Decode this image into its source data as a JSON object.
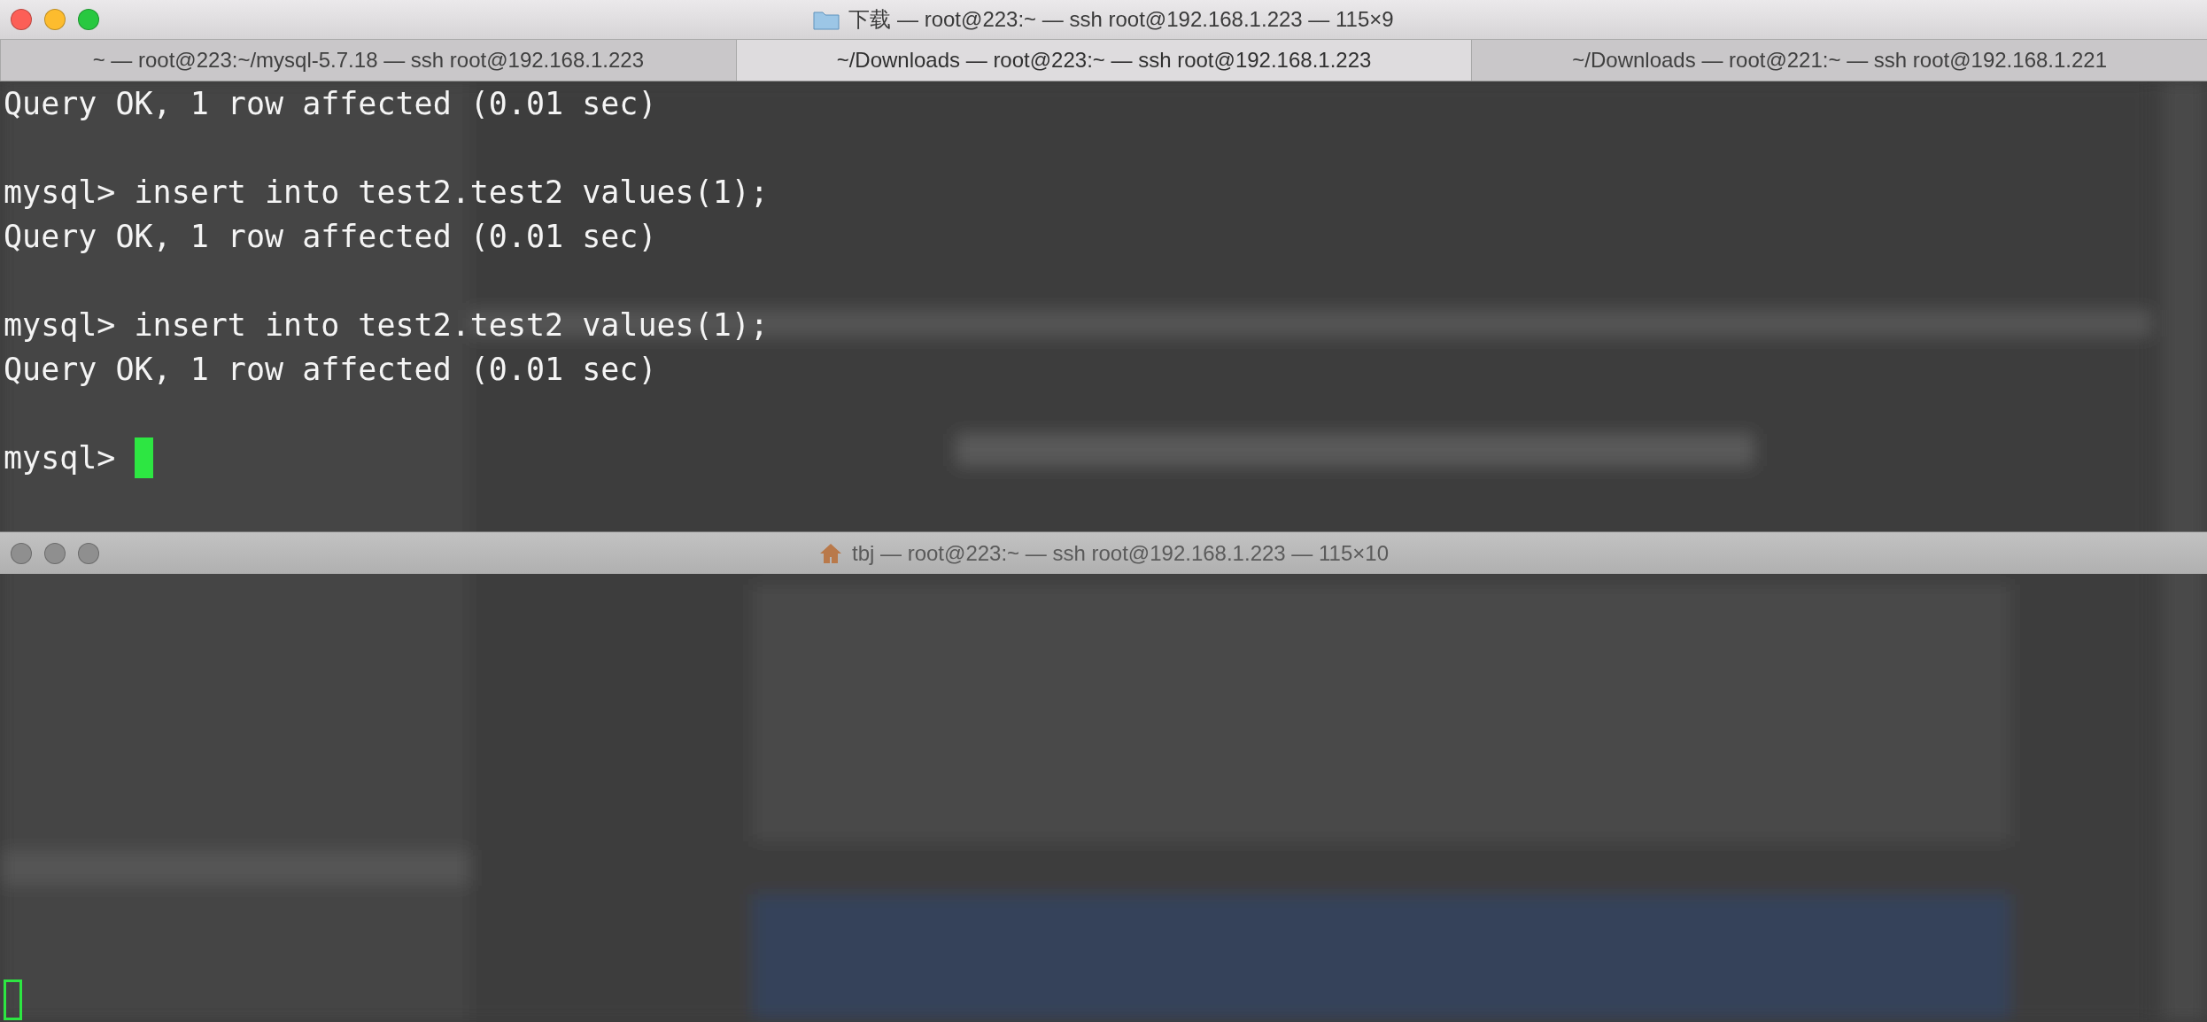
{
  "windows": [
    {
      "title": "下载 — root@223:~ — ssh root@192.168.1.223 — 115×9",
      "active": true,
      "tabs": [
        {
          "label": "~ — root@223:~/mysql-5.7.18 — ssh root@192.168.1.223",
          "selected": false
        },
        {
          "label": "~/Downloads — root@223:~ — ssh root@192.168.1.223",
          "selected": true
        },
        {
          "label": "~/Downloads — root@221:~ — ssh root@192.168.1.221",
          "selected": false
        }
      ],
      "blocks": [
        [
          "Query OK, 1 row affected (0.01 sec)"
        ],
        [
          "mysql> insert into test2.test2 values(1);",
          "Query OK, 1 row affected (0.01 sec)"
        ],
        [
          "mysql> insert into test2.test2 values(1);",
          "Query OK, 1 row affected (0.01 sec)"
        ],
        [
          "mysql> "
        ]
      ]
    },
    {
      "title": "tbj — root@223:~ — ssh root@192.168.1.223 — 115×10",
      "active": false
    }
  ]
}
